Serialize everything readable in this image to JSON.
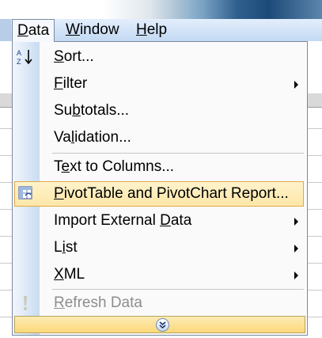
{
  "menubar": {
    "items": [
      {
        "label": "Data",
        "mnemonic": "D",
        "rest": "ata",
        "active": true
      },
      {
        "label": "Window",
        "mnemonic": "W",
        "rest": "indow"
      },
      {
        "label": "Help",
        "mnemonic": "H",
        "rest": "elp"
      }
    ]
  },
  "menu": {
    "items": [
      {
        "label": "Sort...",
        "pre": "",
        "mnemonic": "S",
        "post": "ort...",
        "icon": "sort-ascending-icon",
        "submenu": false
      },
      {
        "label": "Filter",
        "pre": "",
        "mnemonic": "F",
        "post": "ilter",
        "icon": "",
        "submenu": true
      },
      {
        "label": "Subtotals...",
        "pre": "Su",
        "mnemonic": "b",
        "post": "totals...",
        "icon": "",
        "submenu": false
      },
      {
        "label": "Validation...",
        "pre": "Va",
        "mnemonic": "l",
        "post": "idation...",
        "icon": "",
        "submenu": false
      },
      {
        "label": "Text to Columns...",
        "pre": "T",
        "mnemonic": "e",
        "post": "xt to Columns...",
        "icon": "",
        "submenu": false
      },
      {
        "label": "PivotTable and PivotChart Report...",
        "pre": "",
        "mnemonic": "P",
        "post": "ivotTable and PivotChart Report...",
        "icon": "pivottable-icon",
        "submenu": false,
        "highlighted": true
      },
      {
        "label": "Import External Data",
        "pre": "Import External ",
        "mnemonic": "D",
        "post": "ata",
        "icon": "",
        "submenu": true
      },
      {
        "label": "List",
        "pre": "L",
        "mnemonic": "i",
        "post": "st",
        "icon": "",
        "submenu": true
      },
      {
        "label": "XML",
        "pre": "",
        "mnemonic": "X",
        "post": "ML",
        "icon": "",
        "submenu": true
      },
      {
        "label": "Refresh Data",
        "pre": "",
        "mnemonic": "R",
        "post": "efresh Data",
        "icon": "refresh-exclamation-icon",
        "submenu": false,
        "disabled": true
      }
    ],
    "expand_icon": "double-chevron-down-icon"
  },
  "colors": {
    "highlight_fill": "#fde7a8",
    "highlight_border": "#e0a848",
    "gutter": "#c9dcf2",
    "menubar": "#c3d9f3"
  }
}
